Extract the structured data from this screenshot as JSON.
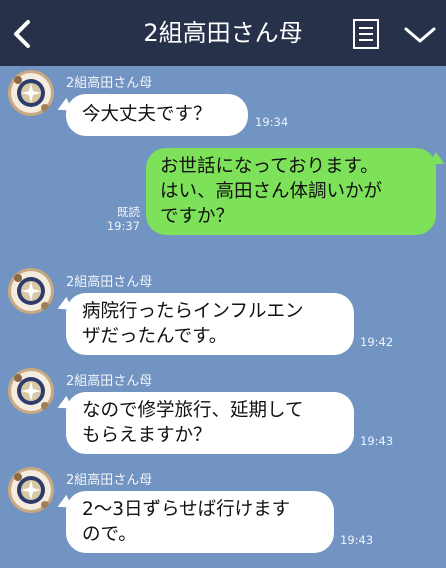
{
  "header": {
    "title": "2組高田さん母",
    "back_icon": "chevron-left-icon",
    "menu_icon": "notes-icon",
    "dropdown_icon": "chevron-down-icon"
  },
  "colors": {
    "background": "#7294c2",
    "header": "#27324a",
    "incoming_bubble": "#ffffff",
    "outgoing_bubble": "#7ee15a"
  },
  "messages": [
    {
      "sender": "2組高田さん母",
      "text_lines": [
        "今大丈夫です？"
      ],
      "time": "19:34"
    },
    {
      "outgoing": true,
      "text_lines": [
        "お世話になっております。",
        "はい、高田さん体調いかが",
        "ですか？"
      ],
      "read_label": "既読",
      "time": "19:37"
    },
    {
      "sender": "2組高田さん母",
      "text_lines": [
        "病院行ったらインフルエン",
        "ザだったんです。"
      ],
      "time": "19:42"
    },
    {
      "sender": "2組高田さん母",
      "text_lines": [
        "なので修学旅行、延期して",
        "もらえますか？"
      ],
      "time": "19:43"
    },
    {
      "sender": "2組高田さん母",
      "text_lines": [
        "2〜3日ずらせば行けます",
        "ので。"
      ],
      "time": "19:43"
    }
  ]
}
